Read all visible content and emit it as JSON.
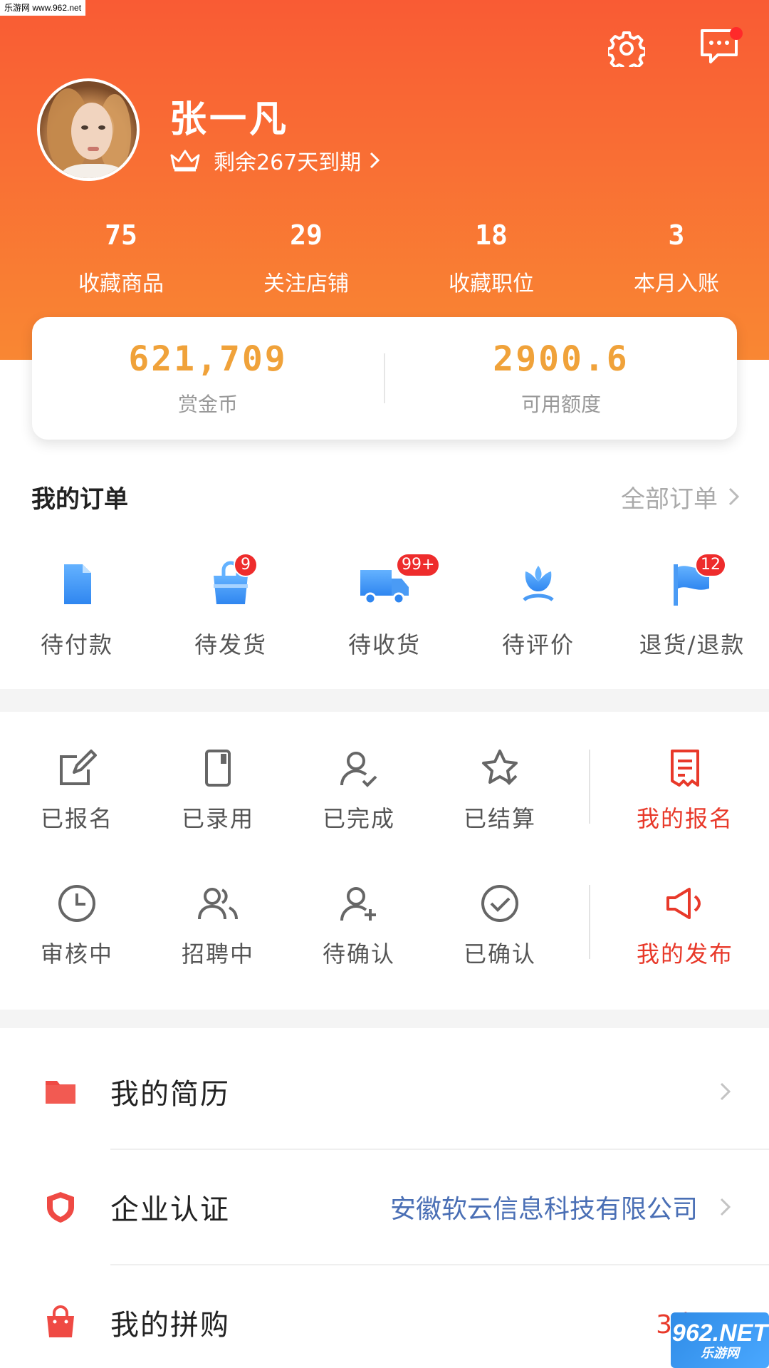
{
  "watermark_top": "乐游网 www.962.net",
  "profile": {
    "name": "张一凡",
    "vip_text": "剩余267天到期"
  },
  "stats": [
    {
      "value": "75",
      "label": "收藏商品"
    },
    {
      "value": "29",
      "label": "关注店铺"
    },
    {
      "value": "18",
      "label": "收藏职位"
    },
    {
      "value": "3",
      "label": "本月入账"
    }
  ],
  "wallet": [
    {
      "value": "621,709",
      "label": "赏金币"
    },
    {
      "value": "2900.6",
      "label": "可用额度"
    }
  ],
  "orders": {
    "title": "我的订单",
    "all_label": "全部订单",
    "items": [
      {
        "label": "待付款",
        "icon": "document-icon",
        "badge": ""
      },
      {
        "label": "待发货",
        "icon": "shopping-bag-icon",
        "badge": "9"
      },
      {
        "label": "待收货",
        "icon": "delivery-truck-icon",
        "badge": "99+"
      },
      {
        "label": "待评价",
        "icon": "flower-icon",
        "badge": ""
      },
      {
        "label": "退货/退款",
        "icon": "flag-icon",
        "badge": "12"
      }
    ]
  },
  "jobs": {
    "row1": [
      {
        "label": "已报名",
        "icon": "edit-icon"
      },
      {
        "label": "已录用",
        "icon": "phone-icon"
      },
      {
        "label": "已完成",
        "icon": "user-check-icon"
      },
      {
        "label": "已结算",
        "icon": "star-check-icon"
      }
    ],
    "row1_feature": {
      "label": "我的报名",
      "icon": "signup-doc-icon"
    },
    "row2": [
      {
        "label": "审核中",
        "icon": "clock-icon"
      },
      {
        "label": "招聘中",
        "icon": "users-icon"
      },
      {
        "label": "待确认",
        "icon": "user-plus-icon"
      },
      {
        "label": "已确认",
        "icon": "check-circle-icon"
      }
    ],
    "row2_feature": {
      "label": "我的发布",
      "icon": "megaphone-icon"
    }
  },
  "menu": [
    {
      "title": "我的简历",
      "value": "",
      "icon": "folder-icon"
    },
    {
      "title": "企业认证",
      "value": "安徽软云信息科技有限公司",
      "icon": "shield-icon"
    },
    {
      "title": "我的拼购",
      "value": "3张",
      "icon": "bag-icon"
    }
  ],
  "colors": {
    "header_top": "#f95b34",
    "header_bottom": "#f98733",
    "wallet_value": "#f0a23a",
    "accent_red": "#e8392a",
    "link_blue": "#4a6fb5",
    "badge_red": "#ee2c2c"
  },
  "watermark_br": {
    "line1": "962.NET",
    "line2": "乐游网"
  }
}
